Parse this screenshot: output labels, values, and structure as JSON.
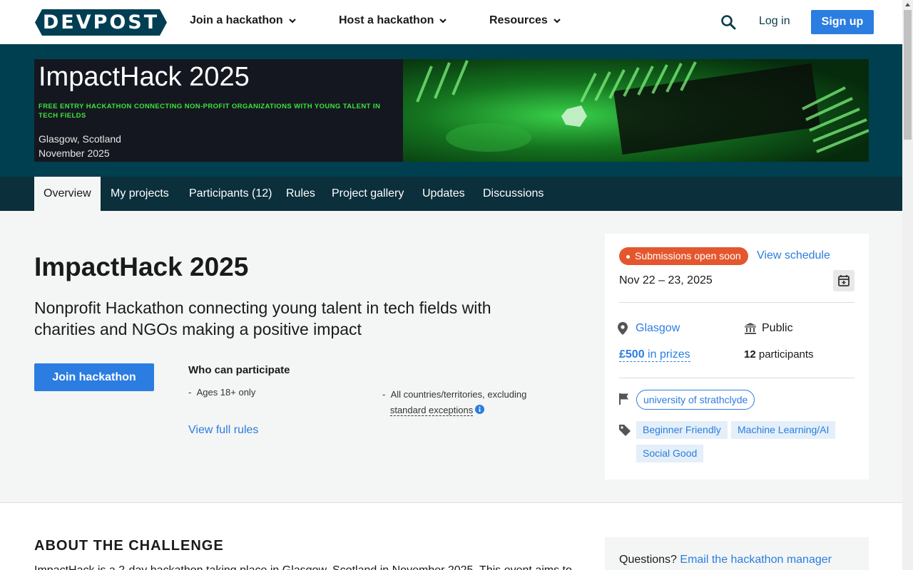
{
  "header": {
    "logo_text": "DEVPOST",
    "nav": [
      {
        "label": "Join a hackathon"
      },
      {
        "label": "Host a hackathon"
      },
      {
        "label": "Resources"
      }
    ],
    "login": "Log in",
    "signup": "Sign up"
  },
  "banner": {
    "title": "ImpactHack 2025",
    "tagline": "FREE ENTRY HACKATHON CONNECTING NON-PROFIT ORGANIZATIONS WITH YOUNG TALENT IN TECH FIELDS",
    "location": "Glasgow, Scotland",
    "month": "November 2025"
  },
  "tabs": [
    {
      "label": "Overview",
      "active": true
    },
    {
      "label": "My projects"
    },
    {
      "label": "Participants (12)"
    },
    {
      "label": "Rules"
    },
    {
      "label": "Project gallery"
    },
    {
      "label": "Updates"
    },
    {
      "label": "Discussions"
    }
  ],
  "main": {
    "title": "ImpactHack 2025",
    "subtitle": "Nonprofit Hackathon connecting young talent in tech fields with charities and NGOs making a positive impact",
    "join_button": "Join hackathon",
    "who_title": "Who can participate",
    "eligibility": {
      "age": "Ages 18+ only",
      "countries_prefix": "All countries/territories, excluding",
      "countries_link": "standard exceptions"
    },
    "view_rules": "View full rules"
  },
  "sidebar": {
    "status_badge": "Submissions open soon",
    "view_schedule": "View schedule",
    "dates": "Nov 22 – 23, 2025",
    "location": "Glasgow",
    "visibility": "Public",
    "prize_amount": "£500",
    "prize_suffix": " in prizes",
    "participant_count": "12",
    "participant_suffix": " participants",
    "host": "university of strathclyde",
    "themes": [
      "Beginner Friendly",
      "Machine Learning/AI",
      "Social Good"
    ],
    "colors": {
      "accent": "#2b7de1",
      "badge": "#e4572e",
      "band": "#003f4f"
    }
  },
  "about": {
    "heading": "ABOUT THE CHALLENGE",
    "body": "ImpactHack is a 2-day hackathon taking place in Glasgow, Scotland in November 2025. This event aims to"
  },
  "questions": {
    "prefix": "Questions? ",
    "link": "Email the hackathon manager"
  }
}
